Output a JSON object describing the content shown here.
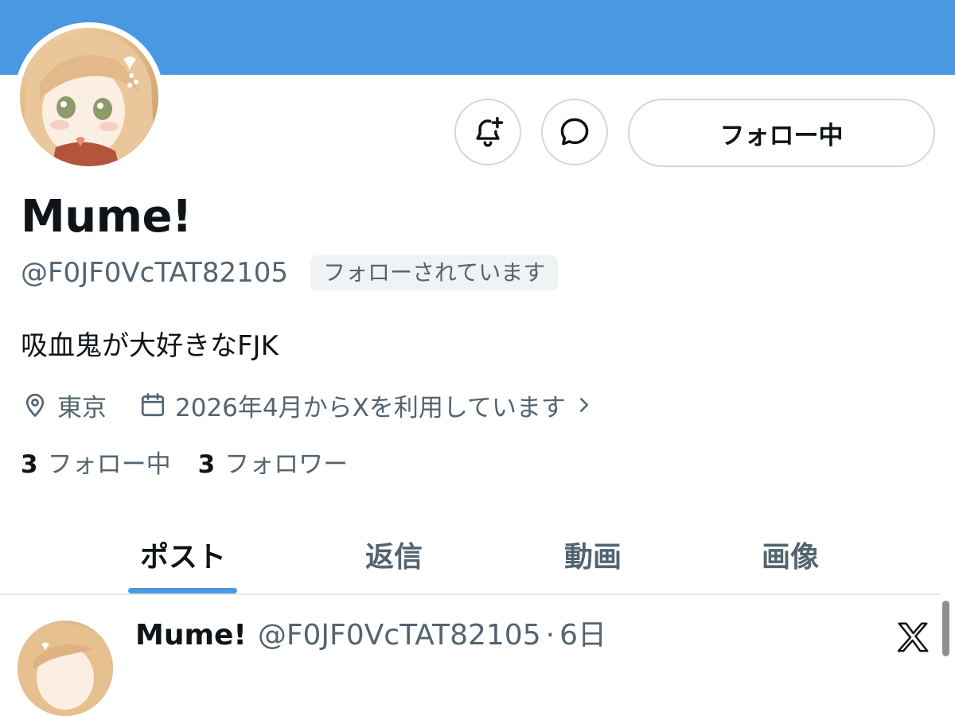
{
  "profile": {
    "display_name": "Mume!",
    "handle": "@F0JF0VcTAT82105",
    "follows_you": "フォローされています",
    "bio": "吸血鬼が大好きなFJK",
    "location": "東京",
    "joined": "2026年4月からXを利用しています"
  },
  "actions": {
    "follow_label": "フォロー中",
    "notify_icon": "bell-plus-icon",
    "message_icon": "message-bubble-icon"
  },
  "stats": {
    "following_count": "3",
    "following_label": "フォロー中",
    "followers_count": "3",
    "followers_label": "フォロワー"
  },
  "tabs": [
    {
      "label": "ポスト",
      "active": true
    },
    {
      "label": "返信",
      "active": false
    },
    {
      "label": "動画",
      "active": false
    },
    {
      "label": "画像",
      "active": false
    }
  ],
  "post": {
    "name": "Mume!",
    "handle": "@F0JF0VcTAT82105",
    "separator": "·",
    "time": "6日"
  },
  "colors": {
    "banner": "#4a98e2",
    "accent": "#4a98e2",
    "text_primary": "#0f1419",
    "text_secondary": "#536471"
  }
}
